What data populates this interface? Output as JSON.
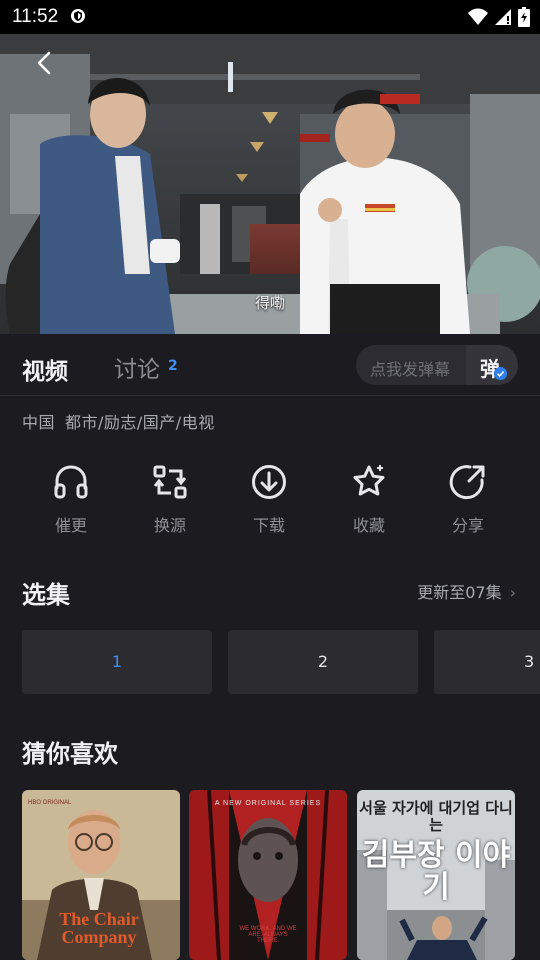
{
  "status_bar": {
    "time": "11:52"
  },
  "video": {
    "subtitle": "得嘞"
  },
  "tabs": {
    "video": "视频",
    "discuss": "讨论",
    "discuss_count": "2"
  },
  "danmaku": {
    "placeholder": "点我发弹幕",
    "toggle": "弹"
  },
  "meta": {
    "region": "中国",
    "genres": "都市/励志/国产/电视"
  },
  "actions": [
    {
      "label": "催更",
      "icon": "headphones-icon"
    },
    {
      "label": "换源",
      "icon": "switch-source-icon"
    },
    {
      "label": "下载",
      "icon": "download-icon"
    },
    {
      "label": "收藏",
      "icon": "star-icon"
    },
    {
      "label": "分享",
      "icon": "share-icon"
    }
  ],
  "episodes": {
    "title": "选集",
    "update": "更新至07集",
    "items": [
      "1",
      "2",
      "3"
    ],
    "selected": "1"
  },
  "recommend": {
    "title": "猜你喜欢",
    "posters": [
      {
        "title": "The Chair Company",
        "brand": "HBO ORIGINAL"
      },
      {
        "title": "A NEW ORIGINAL SERIES",
        "tagline": "WE WORK. AND WE ARE. ALWAYS THERE."
      },
      {
        "title": "김부장 이야기",
        "subtitle": "서울 자가에 대기업 다니는"
      }
    ]
  },
  "colors": {
    "accent": "#3b8ff5",
    "background": "#1c1c20"
  }
}
